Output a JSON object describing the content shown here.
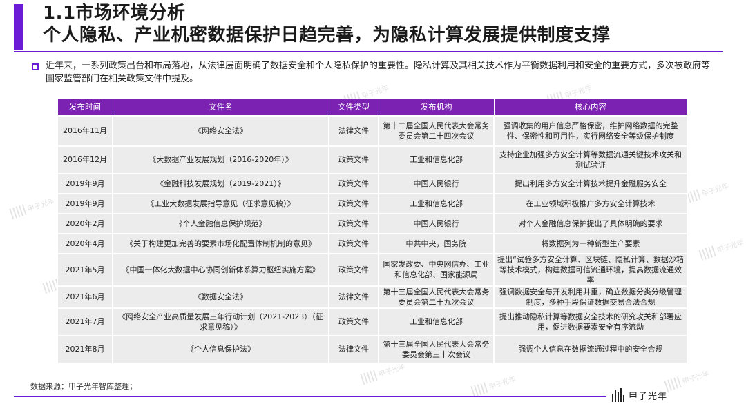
{
  "header": {
    "title_line1": "1.1市场环境分析",
    "title_line2": "个人隐私、产业机密数据保护日趋完善，为隐私计算发展提供制度支撑",
    "accent_color": "#6a1bd6"
  },
  "intro": {
    "text": "近年来，一系列政策出台和布局落地，从法律层面明确了数据安全和个人隐私保护的重要性。隐私计算及其相关技术作为平衡数据利用和安全的重要方式，多次被政府等国家监管部门在相关政策文件中提及。"
  },
  "table": {
    "header_color": "#7b22b3",
    "headers": [
      "发布时间",
      "文件名",
      "文件类型",
      "发布机构",
      "核心内容"
    ],
    "rows": [
      [
        "2016年11月",
        "《网络安全法》",
        "法律文件",
        "第十二届全国人民代表大会常务委员会第二十四次会议",
        "强调收集的用户信息严格保密，维护网络数据的完整性、保密性和可用性，实行网络安全等级保护制度"
      ],
      [
        "2016年12月",
        "《大数据产业发展规划（2016-2020年）》",
        "政策文件",
        "工业和信息化部",
        "支持企业加强多方安全计算等数据流通关键技术攻关和测试验证"
      ],
      [
        "2019年9月",
        "《金融科技发展规划（2019-2021）》",
        "政策文件",
        "中国人民银行",
        "提出利用多方安全计算技术提升金融服务安全"
      ],
      [
        "2019年9月",
        "《工业大数据发展指导意见（征求意见稿）》",
        "政策文件",
        "工业和信息化部",
        "在工业领域积极推广多方安全计算技术"
      ],
      [
        "2020年2月",
        "《个人金融信息保护规范》",
        "政策文件",
        "中国人民银行",
        "对个人金融信息保护提出了具体明确的要求"
      ],
      [
        "2020年4月",
        "《关于构建更加完善的要素市场化配置体制机制的意见》",
        "政策文件",
        "中共中央，国务院",
        "将数据列为一种新型生产要素"
      ],
      [
        "2021年5月",
        "《中国一体化大数据中心协同创新体系算力枢纽实施方案》",
        "政策文件",
        "国家发改委、中央网信办、工业和信息化部、国家能源局",
        "提出“试验多方安全计算、区块链、隐私计算、数据沙箱等技术模式，构建数据可信流通环境，提高数据流通效率"
      ],
      [
        "2021年6月",
        "《数据安全法》",
        "法律文件",
        "第十三届全国人民代表大会常务委员会第二十九次会议",
        "强调数据安全与开发利用并重，确立数据分类分级管理制度，多种手段保证数据交易合法合规"
      ],
      [
        "2021年7月",
        "《网络安全产业高质量发展三年行动计划（2021-2023）（征求意见稿）》",
        "政策文件",
        "工业和信息化部",
        "提出推动隐私计算等数据安全技术的研究攻关和部署应用，促进数据要素安全有序流动"
      ],
      [
        "2021年8月",
        "《个人信息保护法》",
        "法律文件",
        "第十三届全国人民代表大会常务委员会第三十次会议",
        "强调个人信息在数据流通过程中的安全合规"
      ]
    ]
  },
  "footer": {
    "source": "数据来源：甲子光年智库整理；",
    "logo_text": "甲子光年"
  },
  "watermark": {
    "text": "甲子光年"
  }
}
